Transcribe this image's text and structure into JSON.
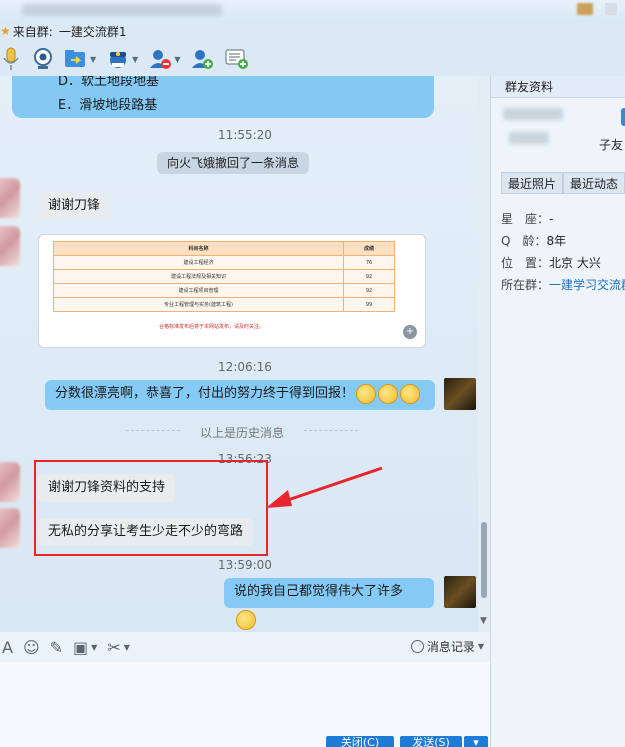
{
  "window": {
    "group_prefix": "来自群:",
    "group_name": "一建交流群1"
  },
  "toolbar": {
    "icons": [
      "voice-icon",
      "video-icon",
      "file-transfer-icon",
      "remote-assist-icon",
      "remove-member-icon",
      "add-member-icon",
      "chat-history-icon"
    ]
  },
  "chat": {
    "top_bubble": {
      "option_d": "D．软土地段地基",
      "option_e": "E．滑坡地段路基"
    },
    "time1": "11:55:20",
    "recall_notice": "向火飞娥撤回了一条消息",
    "msg1": "谢谢刀锋",
    "score_table": {
      "headers": [
        "科目名称",
        "成绩"
      ],
      "rows": [
        [
          "建设工程经济",
          "76"
        ],
        [
          "建设工程法规及相关知识",
          "92"
        ],
        [
          "建设工程项目管理",
          "92"
        ],
        [
          "专业工程管理与实务(建筑工程)",
          "99"
        ]
      ],
      "note": "合格标准发布后将于本网站发布，请及时关注。"
    },
    "time2": "12:06:16",
    "msg2": "分数很漂亮啊，恭喜了，付出的努力终于得到回报！",
    "divider": "以上是历史消息",
    "time3": "13:56:23",
    "msg3": "谢谢刀锋资料的支持",
    "msg4": "无私的分享让考生少走不少的弯路",
    "time4": "13:59:00",
    "msg5": "说的我自己都觉得伟大了许多"
  },
  "inputbar": {
    "history_label": "消息记录"
  },
  "buttons": {
    "close": "关闭(C)",
    "send": "发送(S)"
  },
  "panel": {
    "title": "群友资料",
    "friend_suffix": "子友",
    "tabs": [
      "最近照片",
      "最近动态"
    ],
    "zodiac_label": "星　座：",
    "zodiac_value": "-",
    "qage_label": "Q　龄：",
    "qage_value": "8年",
    "location_label": "位　置：",
    "location_value": "北京 大兴",
    "group_label": "所在群：",
    "group_value": "一建学习交流群"
  }
}
